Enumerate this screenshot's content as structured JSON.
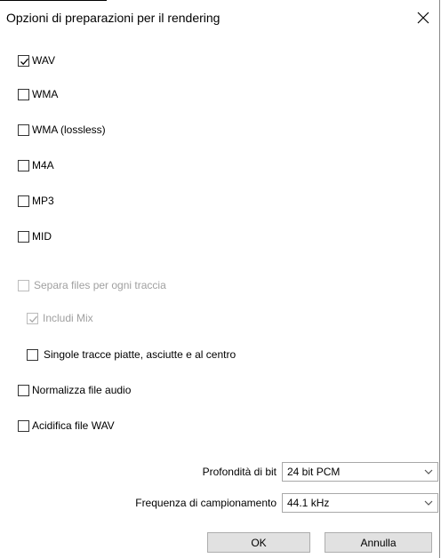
{
  "dialog": {
    "title": "Opzioni di preparazioni per il rendering"
  },
  "formats": [
    {
      "label": "WAV",
      "checked": true
    },
    {
      "label": "WMA",
      "checked": false
    },
    {
      "label": "WMA (lossless)",
      "checked": false
    },
    {
      "label": "M4A",
      "checked": false
    },
    {
      "label": "MP3",
      "checked": false
    },
    {
      "label": "MID",
      "checked": false
    }
  ],
  "options": {
    "separate_files": {
      "label": "Separa files per ogni traccia",
      "checked": false,
      "enabled": false
    },
    "include_mix": {
      "label": "Includi Mix",
      "checked": true,
      "enabled": false
    },
    "flat_dry_centered": {
      "label": "Singole tracce piatte, asciutte e al centro",
      "checked": false,
      "enabled": true
    },
    "normalize": {
      "label": "Normalizza file audio",
      "checked": false,
      "enabled": true
    },
    "acidify": {
      "label": "Acidifica file WAV",
      "checked": false,
      "enabled": true
    }
  },
  "bit_depth": {
    "label": "Profondità di bit",
    "value": "24 bit PCM"
  },
  "sample_rate": {
    "label": "Frequenza di campionamento",
    "value": "44.1 kHz"
  },
  "buttons": {
    "ok": "OK",
    "cancel": "Annulla"
  }
}
